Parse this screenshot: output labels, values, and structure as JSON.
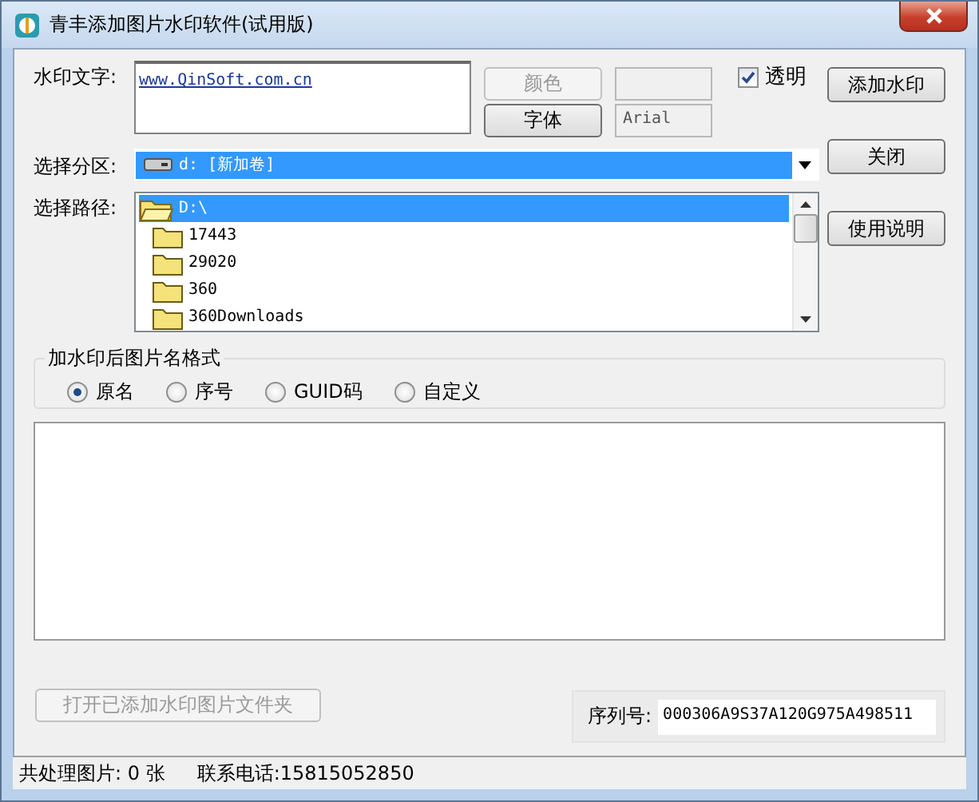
{
  "window": {
    "title": "青丰添加图片水印软件(试用版)"
  },
  "watermark_text": {
    "label": "水印文字:",
    "value": "www.QinSoft.com.cn"
  },
  "color_button": {
    "label": "颜色",
    "disabled": true
  },
  "font_button": {
    "label": "字体",
    "disabled": false
  },
  "font_name": "Arial",
  "transparent": {
    "label": "透明",
    "checked": true
  },
  "add_button": {
    "label": "添加水印"
  },
  "close_button": {
    "label": "关闭"
  },
  "help_button": {
    "label": "使用说明"
  },
  "partition": {
    "label": "选择分区:",
    "value": "d: [新加卷]"
  },
  "path": {
    "label": "选择路径:",
    "tree": [
      {
        "name": "D:\\",
        "selected": true,
        "children": [
          {
            "name": "17443",
            "selected": false
          },
          {
            "name": "29020",
            "selected": false
          },
          {
            "name": "360",
            "selected": false
          },
          {
            "name": "360Downloads",
            "selected": false
          }
        ]
      }
    ]
  },
  "name_format": {
    "title": "加水印后图片名格式",
    "options": [
      {
        "label": "原名",
        "selected": true
      },
      {
        "label": "序号",
        "selected": false
      },
      {
        "label": "GUID码",
        "selected": false
      },
      {
        "label": "自定义",
        "selected": false
      }
    ]
  },
  "open_folder_button": {
    "label": "打开已添加水印图片文件夹",
    "disabled": true
  },
  "serial": {
    "label": "序列号:",
    "value": "000306A9S37A120G975A498511"
  },
  "status_bar": [
    "共处理图片: 0 张",
    "联系电话:15815052850"
  ]
}
